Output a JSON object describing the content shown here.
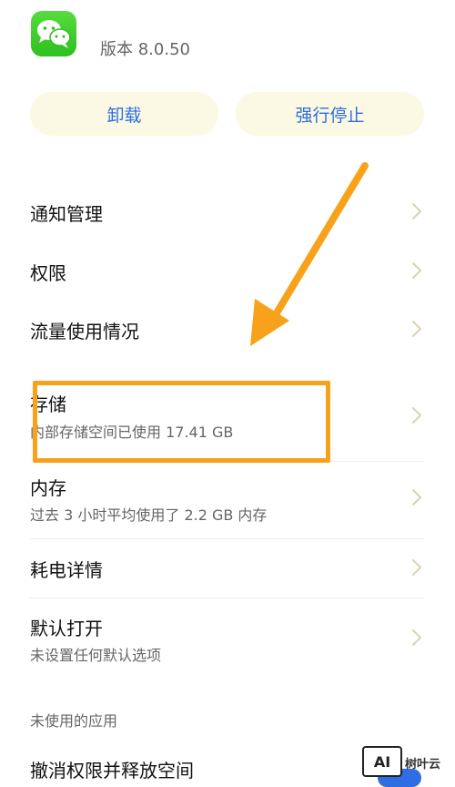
{
  "app": {
    "version": "版本 8.0.50",
    "icon": "wechat-icon"
  },
  "buttons": {
    "uninstall": "卸载",
    "force_stop": "强行停止"
  },
  "settings": {
    "notification": {
      "title": "通知管理"
    },
    "permissions": {
      "title": "权限"
    },
    "data_usage": {
      "title": "流量使用情况"
    },
    "storage": {
      "title": "存储",
      "subtitle": "内部存储空间已使用 17.41 GB"
    },
    "memory": {
      "title": "内存",
      "subtitle": "过去 3 小时平均使用了 2.2 GB 内存"
    },
    "battery": {
      "title": "耗电详情"
    },
    "default_open": {
      "title": "默认打开",
      "subtitle": "未设置任何默认选项"
    }
  },
  "unused_section": {
    "label": "未使用的应用",
    "revoke": {
      "title": "撤消权限并释放空间"
    }
  },
  "annotation": {
    "color": "#f7a21a"
  },
  "watermark": {
    "logo": "AI",
    "text": "树叶云"
  },
  "colors": {
    "accent": "#2d6ee3",
    "button_bg": "#fbf8e3",
    "chevron": "#d8d3b4"
  }
}
